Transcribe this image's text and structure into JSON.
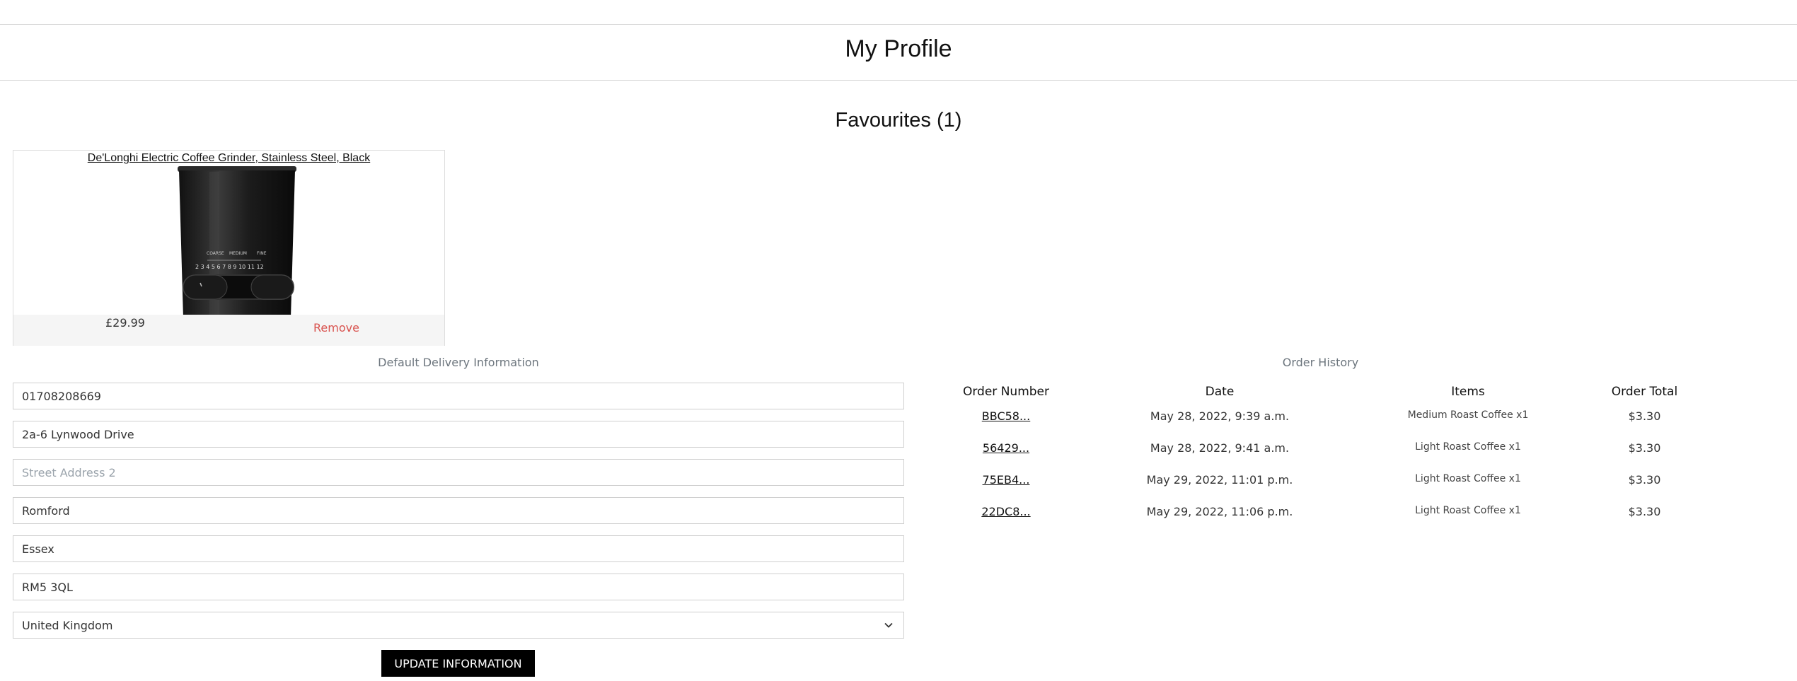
{
  "page": {
    "title": "My Profile"
  },
  "favourites": {
    "heading": "Favourites (1)",
    "items": [
      {
        "name": "De'Longhi Electric Coffee Grinder, Stainless Steel, Black",
        "price": "£29.99",
        "remove_label": "Remove",
        "image_icon": "coffee-grinder-image",
        "image_labels": [
          "COARSE",
          "MEDIUM",
          "FINE"
        ],
        "image_scale": "2 3 4 5 6 7 8 9 10 11 12"
      }
    ]
  },
  "delivery": {
    "heading": "Default Delivery Information",
    "phone": "01708208669",
    "street1": "2a-6 Lynwood Drive",
    "street2_placeholder": "Street Address 2",
    "town": "Romford",
    "county": "Essex",
    "postcode": "RM5 3QL",
    "country": "United Kingdom",
    "update_label": "UPDATE INFORMATION"
  },
  "orders": {
    "heading": "Order History",
    "columns": [
      "Order Number",
      "Date",
      "Items",
      "Order Total"
    ],
    "rows": [
      {
        "number": "BBC58...",
        "date": "May 28, 2022, 9:39 a.m.",
        "items": "Medium Roast Coffee x1",
        "total": "$3.30"
      },
      {
        "number": "56429...",
        "date": "May 28, 2022, 9:41 a.m.",
        "items": "Light Roast Coffee x1",
        "total": "$3.30"
      },
      {
        "number": "75EB4...",
        "date": "May 29, 2022, 11:01 p.m.",
        "items": "Light Roast Coffee x1",
        "total": "$3.30"
      },
      {
        "number": "22DC8...",
        "date": "May 29, 2022, 11:06 p.m.",
        "items": "Light Roast Coffee x1",
        "total": "$3.30"
      }
    ]
  },
  "colors": {
    "remove": "#d9534f",
    "button_bg": "#000000",
    "muted_label": "#6c757d"
  }
}
